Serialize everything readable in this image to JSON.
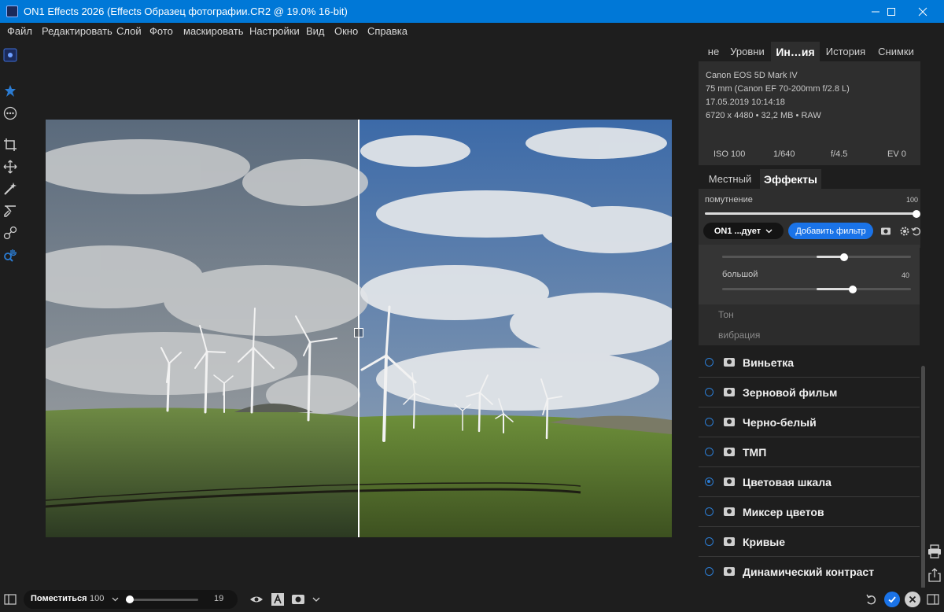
{
  "window": {
    "title": "ON1 Effects 2026 (Effects Образец фотографии.CR2 @ 19.0% 16-bit)"
  },
  "menu": {
    "items": [
      "Файл",
      "Редактировать",
      "Слой",
      "Фото",
      "маскировать",
      "Настройки",
      "Вид",
      "Окно",
      "Справка"
    ]
  },
  "top_tabs": [
    "не",
    "Уровни",
    "Ин…ия",
    "История",
    "Снимки"
  ],
  "info": {
    "camera": "Canon EOS 5D Mark IV",
    "lens": "75 mm (Canon EF 70-200mm f/2.8 L)",
    "date": "17.05.2019 10:14:18",
    "size": "6720 x 4480 • 32,2 MB • RAW",
    "iso": "ISO 100",
    "shutter": "1/640",
    "aperture": "f/4.5",
    "ev": "EV 0"
  },
  "mid_tabs": [
    "Местный",
    "Эффекты"
  ],
  "effects_header": {
    "opacity_label": "помутнение",
    "opacity_value": "100",
    "preset_label": "ON1 ...дует",
    "add_filter_label": "Добавить фильтр"
  },
  "filter_panel": {
    "slider2_label": "большой",
    "slider2_value": "40",
    "sub_sections": [
      "Тон",
      "вибрация"
    ]
  },
  "filters": [
    {
      "name": "Виньетка",
      "active": false
    },
    {
      "name": "Зерновой фильм",
      "active": false
    },
    {
      "name": "Черно-белый",
      "active": false
    },
    {
      "name": "ТМП",
      "active": false
    },
    {
      "name": "Цветовая шкала",
      "active": true
    },
    {
      "name": "Миксер цветов",
      "active": false
    },
    {
      "name": "Кривые",
      "active": false
    },
    {
      "name": "Динамический контраст",
      "active": false
    }
  ],
  "bottom": {
    "fit_label": "Поместиться",
    "zoom_percent": "100",
    "zoom_value": "19"
  },
  "colors": {
    "accent": "#1a73e8",
    "titlebar": "#0078d7",
    "panel_bg": "#2e2e2e"
  }
}
